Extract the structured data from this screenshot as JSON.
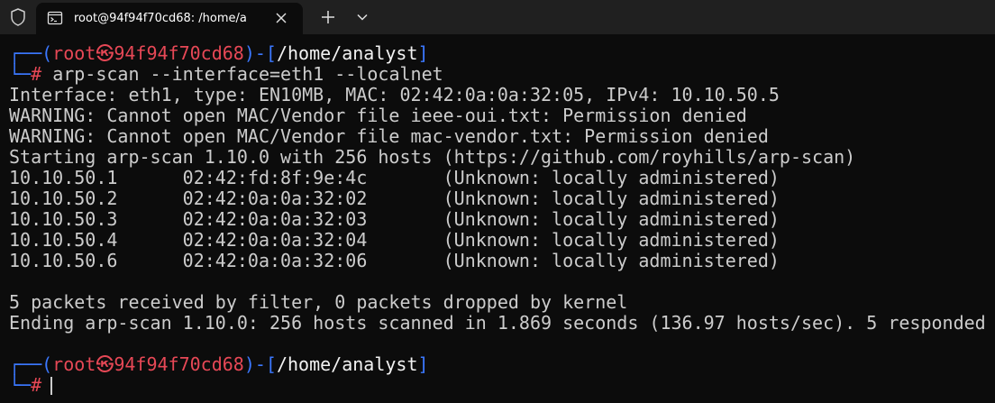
{
  "window": {
    "tab_title": "root@94f94f70cd68: /home/a",
    "accent_prompt_blue": "#3b78ff",
    "accent_prompt_red": "#e74856",
    "foreground": "#cccccc",
    "background": "#0c0c0c",
    "icons": [
      "shield-icon",
      "terminal-tab-icon",
      "close-icon",
      "plus-icon",
      "chevron-down-icon"
    ]
  },
  "prompt": {
    "top_left": "┌──(",
    "user": "root",
    "skull": "㉿",
    "host": "94f94f70cd68",
    "mid": ")-[",
    "path": "/home/analyst",
    "end": "]",
    "bottom_left": "└─",
    "hash": "#"
  },
  "command": "arp-scan --interface=eth1 --localnet",
  "output": [
    "Interface: eth1, type: EN10MB, MAC: 02:42:0a:0a:32:05, IPv4: 10.10.50.5",
    "WARNING: Cannot open MAC/Vendor file ieee-oui.txt: Permission denied",
    "WARNING: Cannot open MAC/Vendor file mac-vendor.txt: Permission denied",
    "Starting arp-scan 1.10.0 with 256 hosts (https://github.com/royhills/arp-scan)",
    "10.10.50.1      02:42:fd:8f:9e:4c       (Unknown: locally administered)",
    "10.10.50.2      02:42:0a:0a:32:02       (Unknown: locally administered)",
    "10.10.50.3      02:42:0a:0a:32:03       (Unknown: locally administered)",
    "10.10.50.4      02:42:0a:0a:32:04       (Unknown: locally administered)",
    "10.10.50.6      02:42:0a:0a:32:06       (Unknown: locally administered)",
    "",
    "5 packets received by filter, 0 packets dropped by kernel",
    "Ending arp-scan 1.10.0: 256 hosts scanned in 1.869 seconds (136.97 hosts/sec). 5 responded"
  ]
}
